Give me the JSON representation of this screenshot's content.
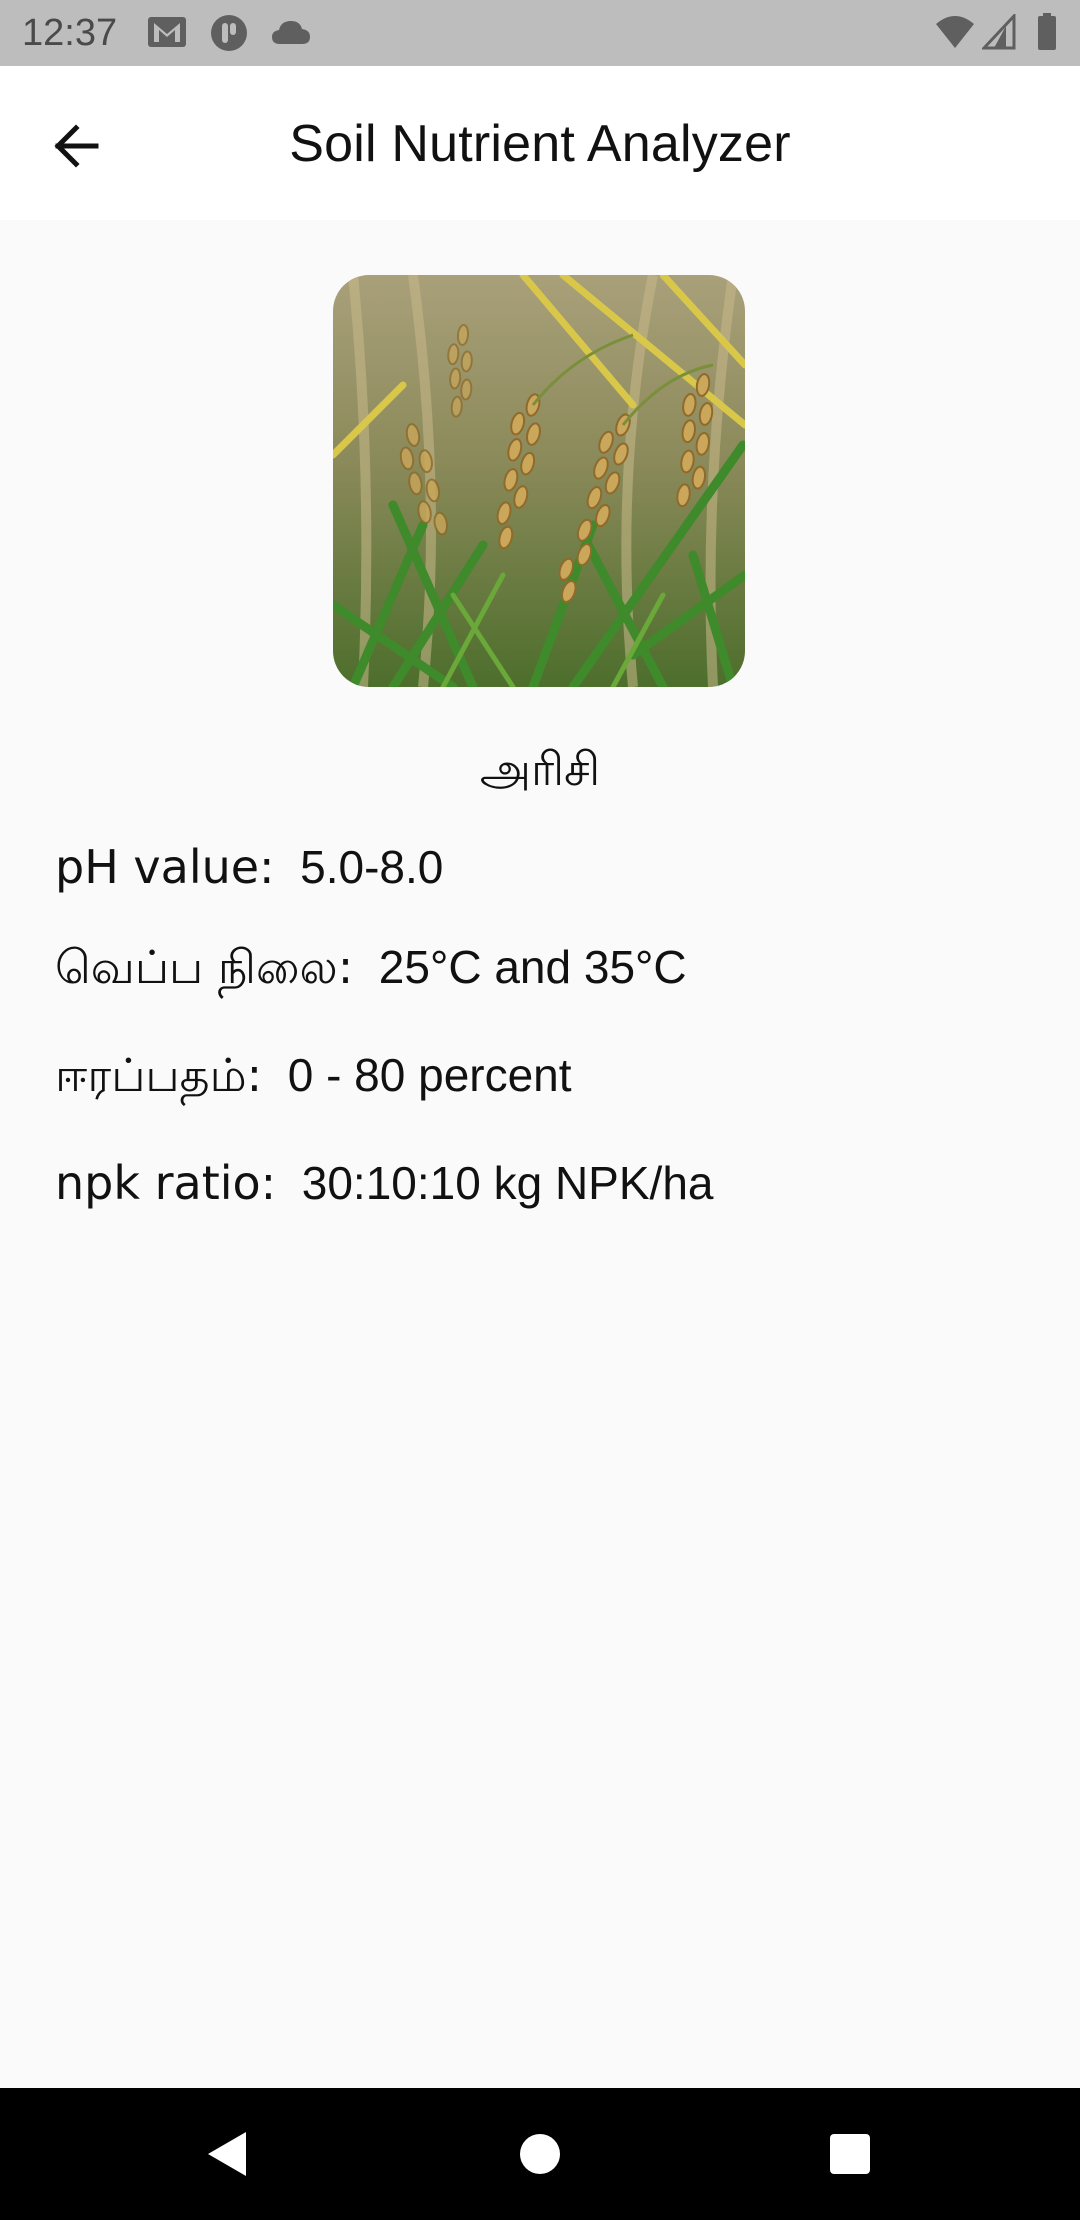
{
  "status_bar": {
    "time": "12:37"
  },
  "app_bar": {
    "title": "Soil Nutrient Analyzer"
  },
  "crop": {
    "name": "அரிசி"
  },
  "details": [
    {
      "label": "pH value:",
      "value": "5.0-8.0"
    },
    {
      "label": "வெப்ப நிலை:",
      "value": "25°C and 35°C"
    },
    {
      "label": "ஈரப்பதம்:",
      "value": "0 - 80 percent"
    },
    {
      "label": "npk ratio:",
      "value": "30:10:10 kg NPK/ha"
    }
  ],
  "colors": {
    "status_bar": "#bdbdbd",
    "app_bar": "#ffffff",
    "background": "#fafafa",
    "nav_bar": "#000000"
  }
}
